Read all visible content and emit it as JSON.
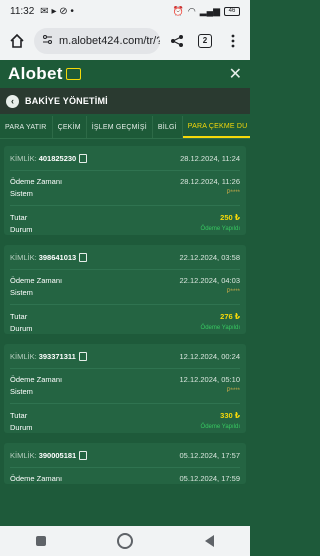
{
  "status_bar": {
    "time": "11:32",
    "battery": "46"
  },
  "browser": {
    "url": "m.alobet424.com/tr/?|",
    "tab_count": "2"
  },
  "app": {
    "logo_main": "Alo",
    "logo_bet": "bet"
  },
  "title_bar": {
    "title": "BAKİYE YÖNETİMİ"
  },
  "tabs": [
    {
      "label": "PARA YATIR"
    },
    {
      "label": "ÇEKİM"
    },
    {
      "label": "İŞLEM GEÇMİŞİ"
    },
    {
      "label": "BİLGİ"
    },
    {
      "label": "PARA ÇEKME DU"
    }
  ],
  "labels": {
    "id": "KİMLİK:",
    "payment_time": "Ödeme Zamanı",
    "system": "Sistem",
    "amount": "Tutar",
    "status": "Durum"
  },
  "records": [
    {
      "id": "401825230",
      "date": "28.12.2024, 11:24",
      "payment_time": "28.12.2024, 11:26",
      "system": "P****",
      "amount": "250 ₺",
      "status": "Ödeme Yapıldı"
    },
    {
      "id": "398641013",
      "date": "22.12.2024, 03:58",
      "payment_time": "22.12.2024, 04:03",
      "system": "P****",
      "amount": "276 ₺",
      "status": "Ödeme Yapıldı"
    },
    {
      "id": "393371311",
      "date": "12.12.2024, 00:24",
      "payment_time": "12.12.2024, 05:10",
      "system": "P****",
      "amount": "330 ₺",
      "status": "Ödeme Yapıldı"
    },
    {
      "id": "390005181",
      "date": "05.12.2024, 17:57",
      "payment_time": "05.12.2024, 17:59",
      "system": "",
      "amount": "",
      "status": ""
    }
  ]
}
